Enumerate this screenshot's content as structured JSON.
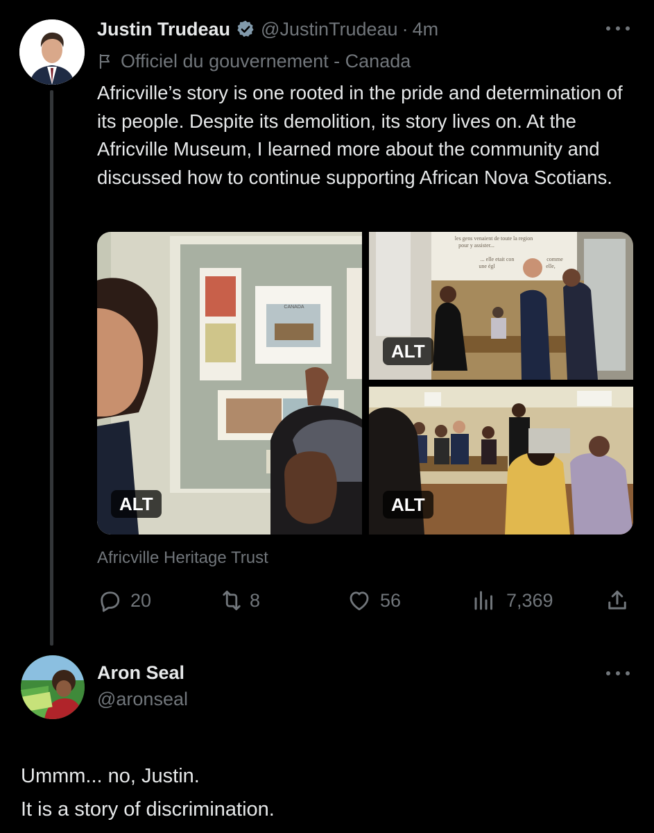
{
  "tweet": {
    "author": {
      "display_name": "Justin Trudeau",
      "handle": "@JustinTrudeau",
      "separator": "·",
      "time": "4m",
      "verified_icon": "verified-badge-icon",
      "government_label": "Officiel du gouvernement - Canada"
    },
    "text": "Africville’s story is one rooted in the pride and determination of its people. Despite its demolition, its story lives on. At the Africville Museum, I learned more about the community and discussed how to continue supporting African Nova Scotians.",
    "media": {
      "photos": [
        {
          "alt_badge": "ALT",
          "stamp_caption": "CANADA"
        },
        {
          "alt_badge": "ALT",
          "wall_text_1": "les gens venaient de toute la region",
          "wall_text_2": "pour y assister...",
          "wall_text_3": "... elle etait con",
          "wall_text_4": "une égl",
          "wall_text_5": "comme",
          "wall_text_6": "elle,"
        },
        {
          "alt_badge": "ALT"
        }
      ]
    },
    "source": "Africville Heritage Trust",
    "actions": {
      "replies": "20",
      "retweets": "8",
      "likes": "56",
      "views": "7,369"
    }
  },
  "reply": {
    "display_name": "Aron Seal",
    "handle": "@aronseal",
    "lines": [
      "Ummm... no, Justin.",
      "It is a story of discrimination."
    ]
  },
  "colors": {
    "background": "#000000",
    "primary_text": "#e7e9ea",
    "secondary_text": "#71767b",
    "thread_line": "#333639",
    "verified_gray": "#829aab"
  }
}
